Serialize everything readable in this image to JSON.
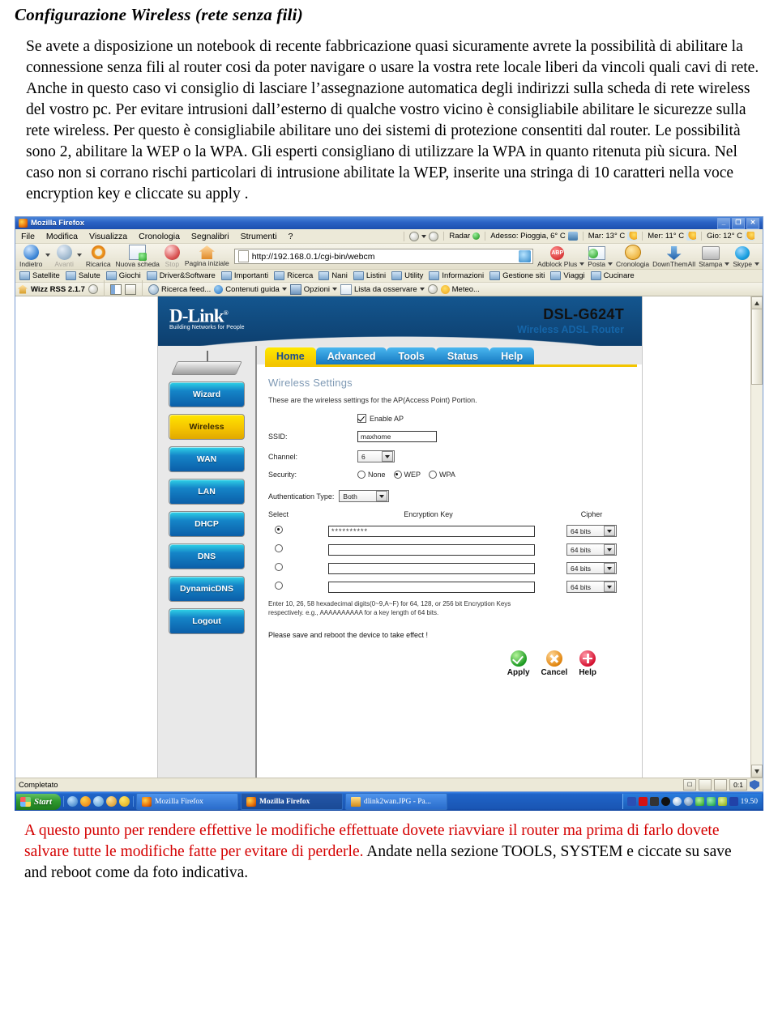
{
  "document": {
    "title": "Configurazione Wireless (rete senza fili)",
    "paragraph1": "Se avete a disposizione un notebook di recente fabbricazione quasi sicuramente avrete la possibilità di abilitare la connessione senza fili al router cosi da poter navigare o usare la vostra rete locale liberi da vincoli quali cavi di rete. Anche in questo caso vi consiglio di lasciare l’assegnazione automatica degli indirizzi sulla scheda di rete wireless del vostro pc. Per evitare intrusioni dall’esterno di qualche vostro vicino è consigliabile abilitare le sicurezze sulla rete wireless. Per questo è consigliabile abilitare uno dei sistemi di protezione consentiti dal router. Le possibilità sono 2, abilitare la WEP o la WPA. Gli esperti consigliano di utilizzare la WPA in quanto ritenuta più sicura. Nel caso non si corrano rischi particolari di intrusione abilitate la WEP, inserite una stringa di 10 caratteri nella voce encryption key e cliccate su apply .",
    "footer_red": "A questo punto per rendere effettive le modifiche effettuate dovete riavviare il router ma prima di farlo dovete salvare tutte le modifiche fatte per evitare di perderle.",
    "footer_black": " Andate nella sezione TOOLS, SYSTEM e ciccate su save and reboot come da foto indicativa.",
    "red_color": "#d40000"
  },
  "browser": {
    "window_title": "Mozilla Firefox",
    "window_buttons": {
      "minimize": "_",
      "restore": "❐",
      "close": "✕"
    },
    "menu": [
      "File",
      "Modifica",
      "Visualizza",
      "Cronologia",
      "Segnalibri",
      "Strumenti",
      "?"
    ],
    "weather": {
      "radar_label": "Radar",
      "cells": [
        {
          "label": "Adesso: Pioggia, 6° C"
        },
        {
          "label": "Mar: 13° C"
        },
        {
          "label": "Mer: 11° C"
        },
        {
          "label": "Gio: 12° C"
        }
      ]
    },
    "nav": {
      "back": "Indietro",
      "forward": "Avanti",
      "reload": "Ricarica",
      "newtab": "Nuova scheda",
      "stop": "Stop",
      "home": "Pagina iniziale",
      "url": "http://192.168.0.1/cgi-bin/webcm"
    },
    "nav_extras": [
      {
        "label": "Adblock Plus",
        "icon": "adblock-icon"
      },
      {
        "label": "Posta",
        "icon": "mail-icon"
      },
      {
        "label": "Cronologia",
        "icon": "history-icon"
      },
      {
        "label": "DownThemAll",
        "icon": "download-icon"
      },
      {
        "label": "Stampa",
        "icon": "printer-icon"
      },
      {
        "label": "Skype",
        "icon": "skype-icon"
      }
    ],
    "bookmarks": [
      "Satellite",
      "Salute",
      "Giochi",
      "Driver&Software",
      "Importanti",
      "Ricerca",
      "Nani",
      "Listini",
      "Utility",
      "Informazioni",
      "Gestione siti",
      "Viaggi",
      "Cucinare"
    ],
    "rss_toolbar": {
      "title": "Wizz RSS 2.1.7",
      "items": [
        "Ricerca feed...",
        "Contenuti guida",
        "Opzioni",
        "Lista da osservare",
        "Meteo..."
      ]
    },
    "status": "Completato",
    "status_right": {
      "counter": "0:1"
    }
  },
  "router": {
    "brand": "D-Link",
    "brand_reg": "®",
    "tagline": "Building Networks for People",
    "model": "DSL-G624T",
    "model_sub": "Wireless ADSL Router",
    "tabs": [
      {
        "label": "Home",
        "active": true
      },
      {
        "label": "Advanced",
        "active": false
      },
      {
        "label": "Tools",
        "active": false
      },
      {
        "label": "Status",
        "active": false
      },
      {
        "label": "Help",
        "active": false
      }
    ],
    "sidebar": [
      {
        "label": "Wizard",
        "active": false
      },
      {
        "label": "Wireless",
        "active": true
      },
      {
        "label": "WAN",
        "active": false
      },
      {
        "label": "LAN",
        "active": false
      },
      {
        "label": "DHCP",
        "active": false
      },
      {
        "label": "DNS",
        "active": false
      },
      {
        "label": "DynamicDNS",
        "active": false
      },
      {
        "label": "Logout",
        "active": false
      }
    ],
    "panel": {
      "title": "Wireless Settings",
      "subtitle": "These are the wireless settings for the AP(Access Point) Portion.",
      "enable_ap_label": "Enable AP",
      "enable_ap_checked": true,
      "ssid_label": "SSID:",
      "ssid_value": "maxhome",
      "channel_label": "Channel:",
      "channel_value": "6",
      "security_label": "Security:",
      "security_options": [
        {
          "label": "None",
          "selected": false
        },
        {
          "label": "WEP",
          "selected": true
        },
        {
          "label": "WPA",
          "selected": false
        }
      ],
      "auth_label": "Authentication Type:",
      "auth_value": "Both",
      "key_headers": {
        "select": "Select",
        "key": "Encryption Key",
        "cipher": "Cipher"
      },
      "key_rows": [
        {
          "selected": true,
          "value": "**********",
          "cipher": "64 bits"
        },
        {
          "selected": false,
          "value": "",
          "cipher": "64 bits"
        },
        {
          "selected": false,
          "value": "",
          "cipher": "64 bits"
        },
        {
          "selected": false,
          "value": "",
          "cipher": "64 bits"
        }
      ],
      "hint_line1": "Enter 10, 26, 58 hexadecimal digits(0~9,A~F) for 64, 128, or 256 bit Encryption Keys",
      "hint_line2": "respectively. e.g., AAAAAAAAAA for a key length of 64 bits.",
      "save_message": "Please save and reboot the device to take effect !",
      "actions": [
        {
          "label": "Apply",
          "icon": "check-icon"
        },
        {
          "label": "Cancel",
          "icon": "cancel-icon"
        },
        {
          "label": "Help",
          "icon": "plus-icon"
        }
      ]
    }
  },
  "taskbar": {
    "start": "Start",
    "windows": [
      {
        "label": "Mozilla Firefox",
        "selected": false,
        "icon": "firefox-icon"
      },
      {
        "label": "Mozilla Firefox",
        "selected": true,
        "icon": "firefox-icon"
      },
      {
        "label": "dlink2wan.JPG - Pa...",
        "selected": false,
        "icon": "paint-icon"
      }
    ],
    "clock": "19.50"
  }
}
